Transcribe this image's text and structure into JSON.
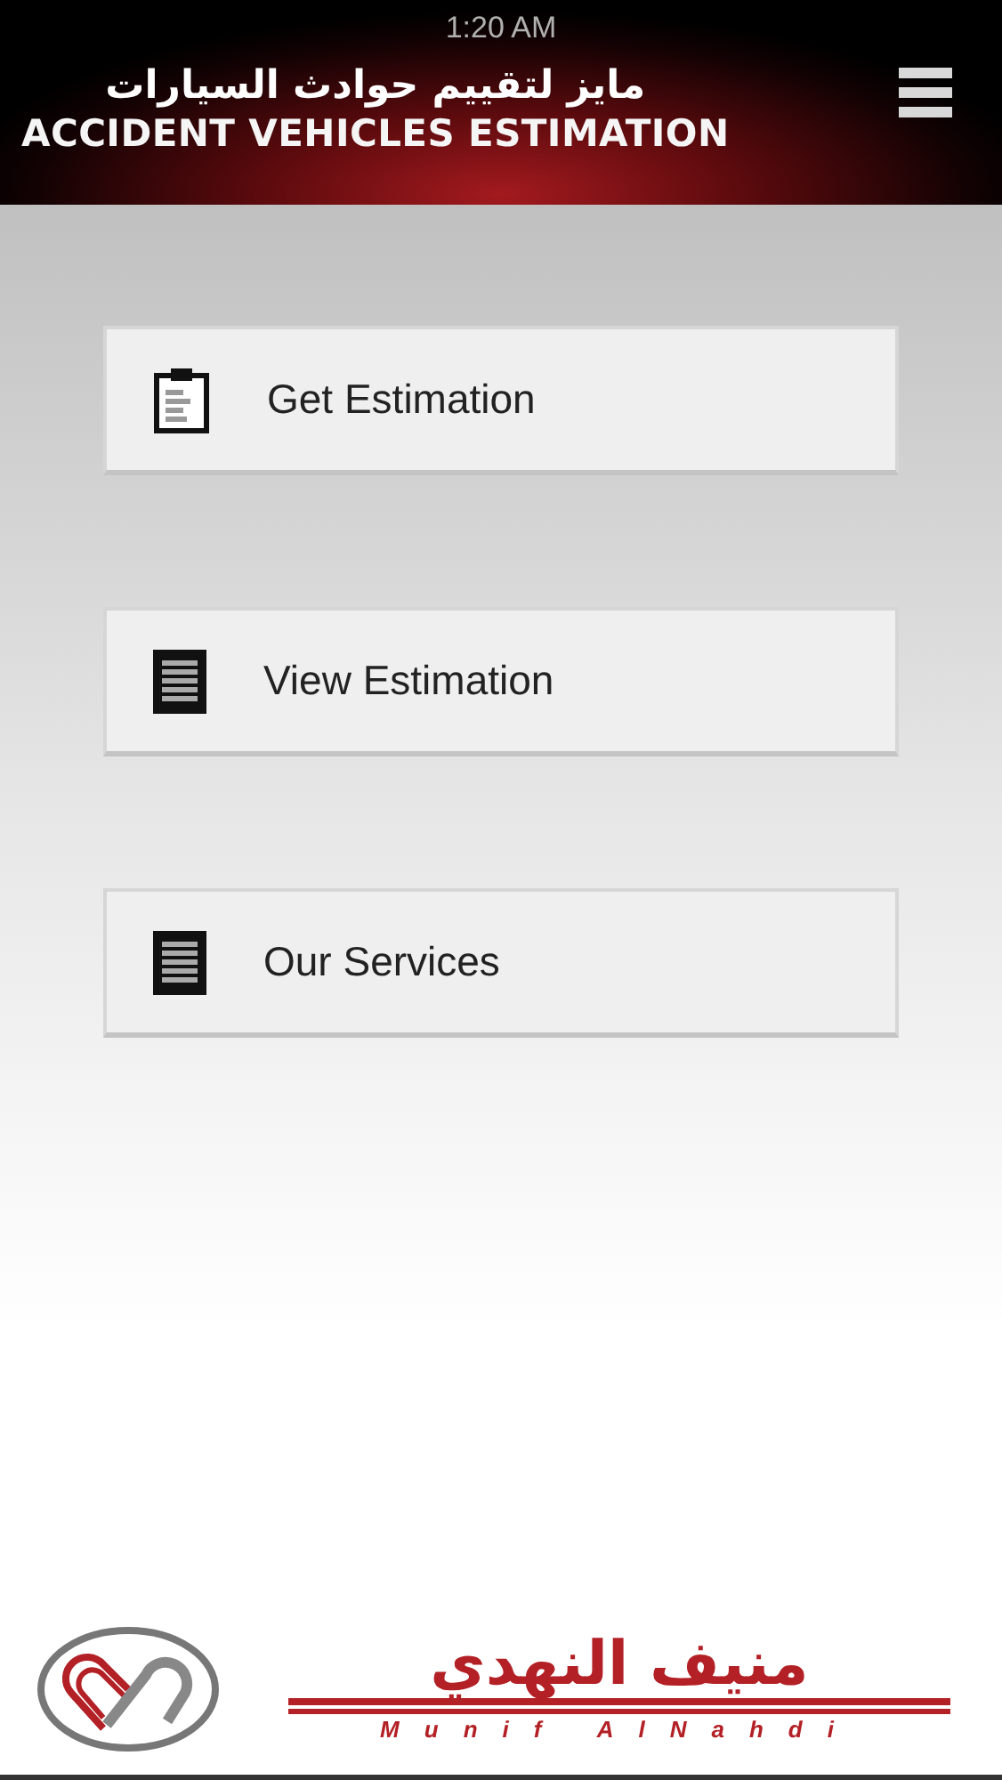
{
  "status_bar": {
    "time": "1:20 AM"
  },
  "header": {
    "title_arabic": "مايز لتقييم حوادث السيارات",
    "title": "ACCIDENT VEHICLES ESTIMATION"
  },
  "menu_buttons": [
    {
      "label": "Get Estimation",
      "kind": "clipboard"
    },
    {
      "label": "View Estimation",
      "kind": "list"
    },
    {
      "label": "Our Services",
      "kind": "list"
    }
  ],
  "footer": {
    "brand_arabic": "منيف النهدي",
    "brand": "Munif AlNahdi"
  }
}
